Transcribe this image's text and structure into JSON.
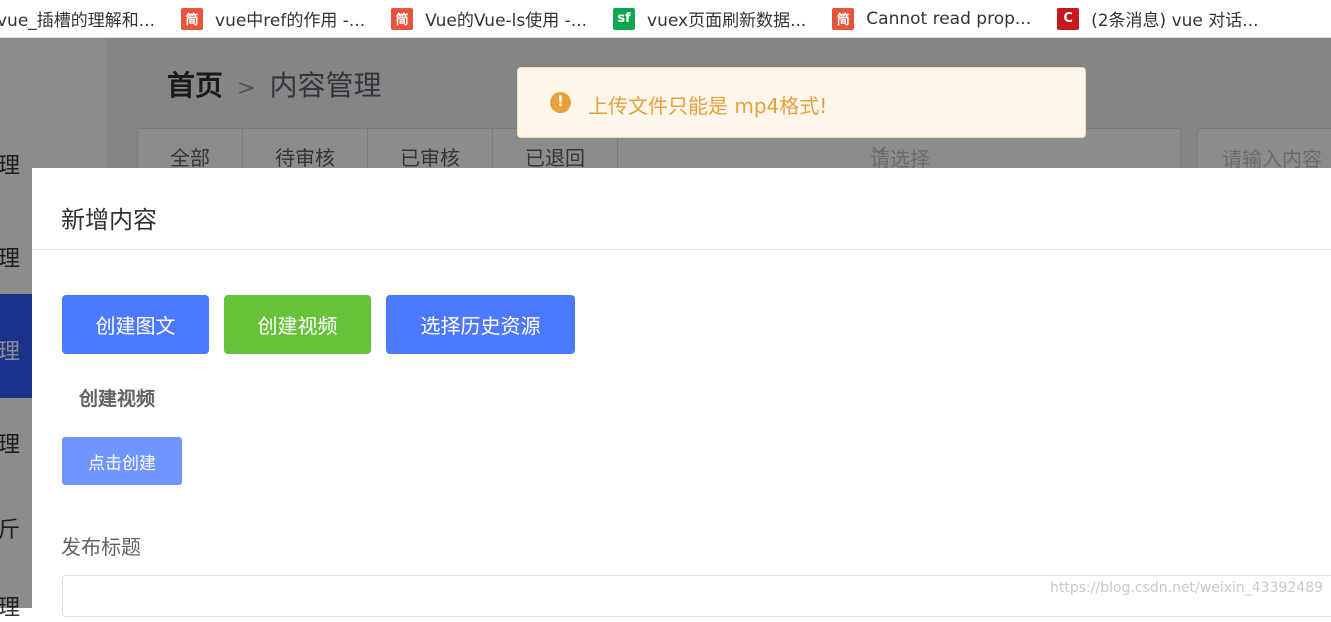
{
  "bookmarks": [
    {
      "icon": "jianshu-icon",
      "label": "vue_插槽的理解和..."
    },
    {
      "icon": "jianshu-icon",
      "label": "vue中ref的作用 -..."
    },
    {
      "icon": "jianshu-icon",
      "label": "Vue的Vue-ls使用 -..."
    },
    {
      "icon": "segmentfault-icon",
      "label": "vuex页面刷新数据..."
    },
    {
      "icon": "jianshu-icon",
      "label": "Cannot read prop..."
    },
    {
      "icon": "csdn-icon",
      "label": "(2条消息) vue 对话..."
    }
  ],
  "icon_glyphs": {
    "jianshu": "简",
    "sf": "sf",
    "csdn": "C"
  },
  "sidebar": {
    "items": [
      "理",
      "理",
      "理",
      "理",
      "斤",
      "理"
    ]
  },
  "breadcrumb": {
    "home": "首页",
    "separator": ">",
    "current": "内容管理"
  },
  "filter_tabs": [
    "全部",
    "待审核",
    "已审核",
    "已退回"
  ],
  "status_select": {
    "placeholder": "请选择"
  },
  "search": {
    "placeholder": "请输入内容"
  },
  "dialog": {
    "title": "新增内容",
    "buttons": {
      "create_article": "创建图文",
      "create_video": "创建视频",
      "select_history": "选择历史资源"
    },
    "section_label": "创建视频",
    "click_create": "点击创建",
    "publish_title_label": "发布标题"
  },
  "toast": {
    "icon": "!",
    "message": "上传文件只能是 mp4格式!"
  },
  "watermark": "https://blog.csdn.net/weixin_43392489",
  "colors": {
    "primary": "#4c79ff",
    "success": "#67c23a",
    "warning": "#e6a23c"
  }
}
